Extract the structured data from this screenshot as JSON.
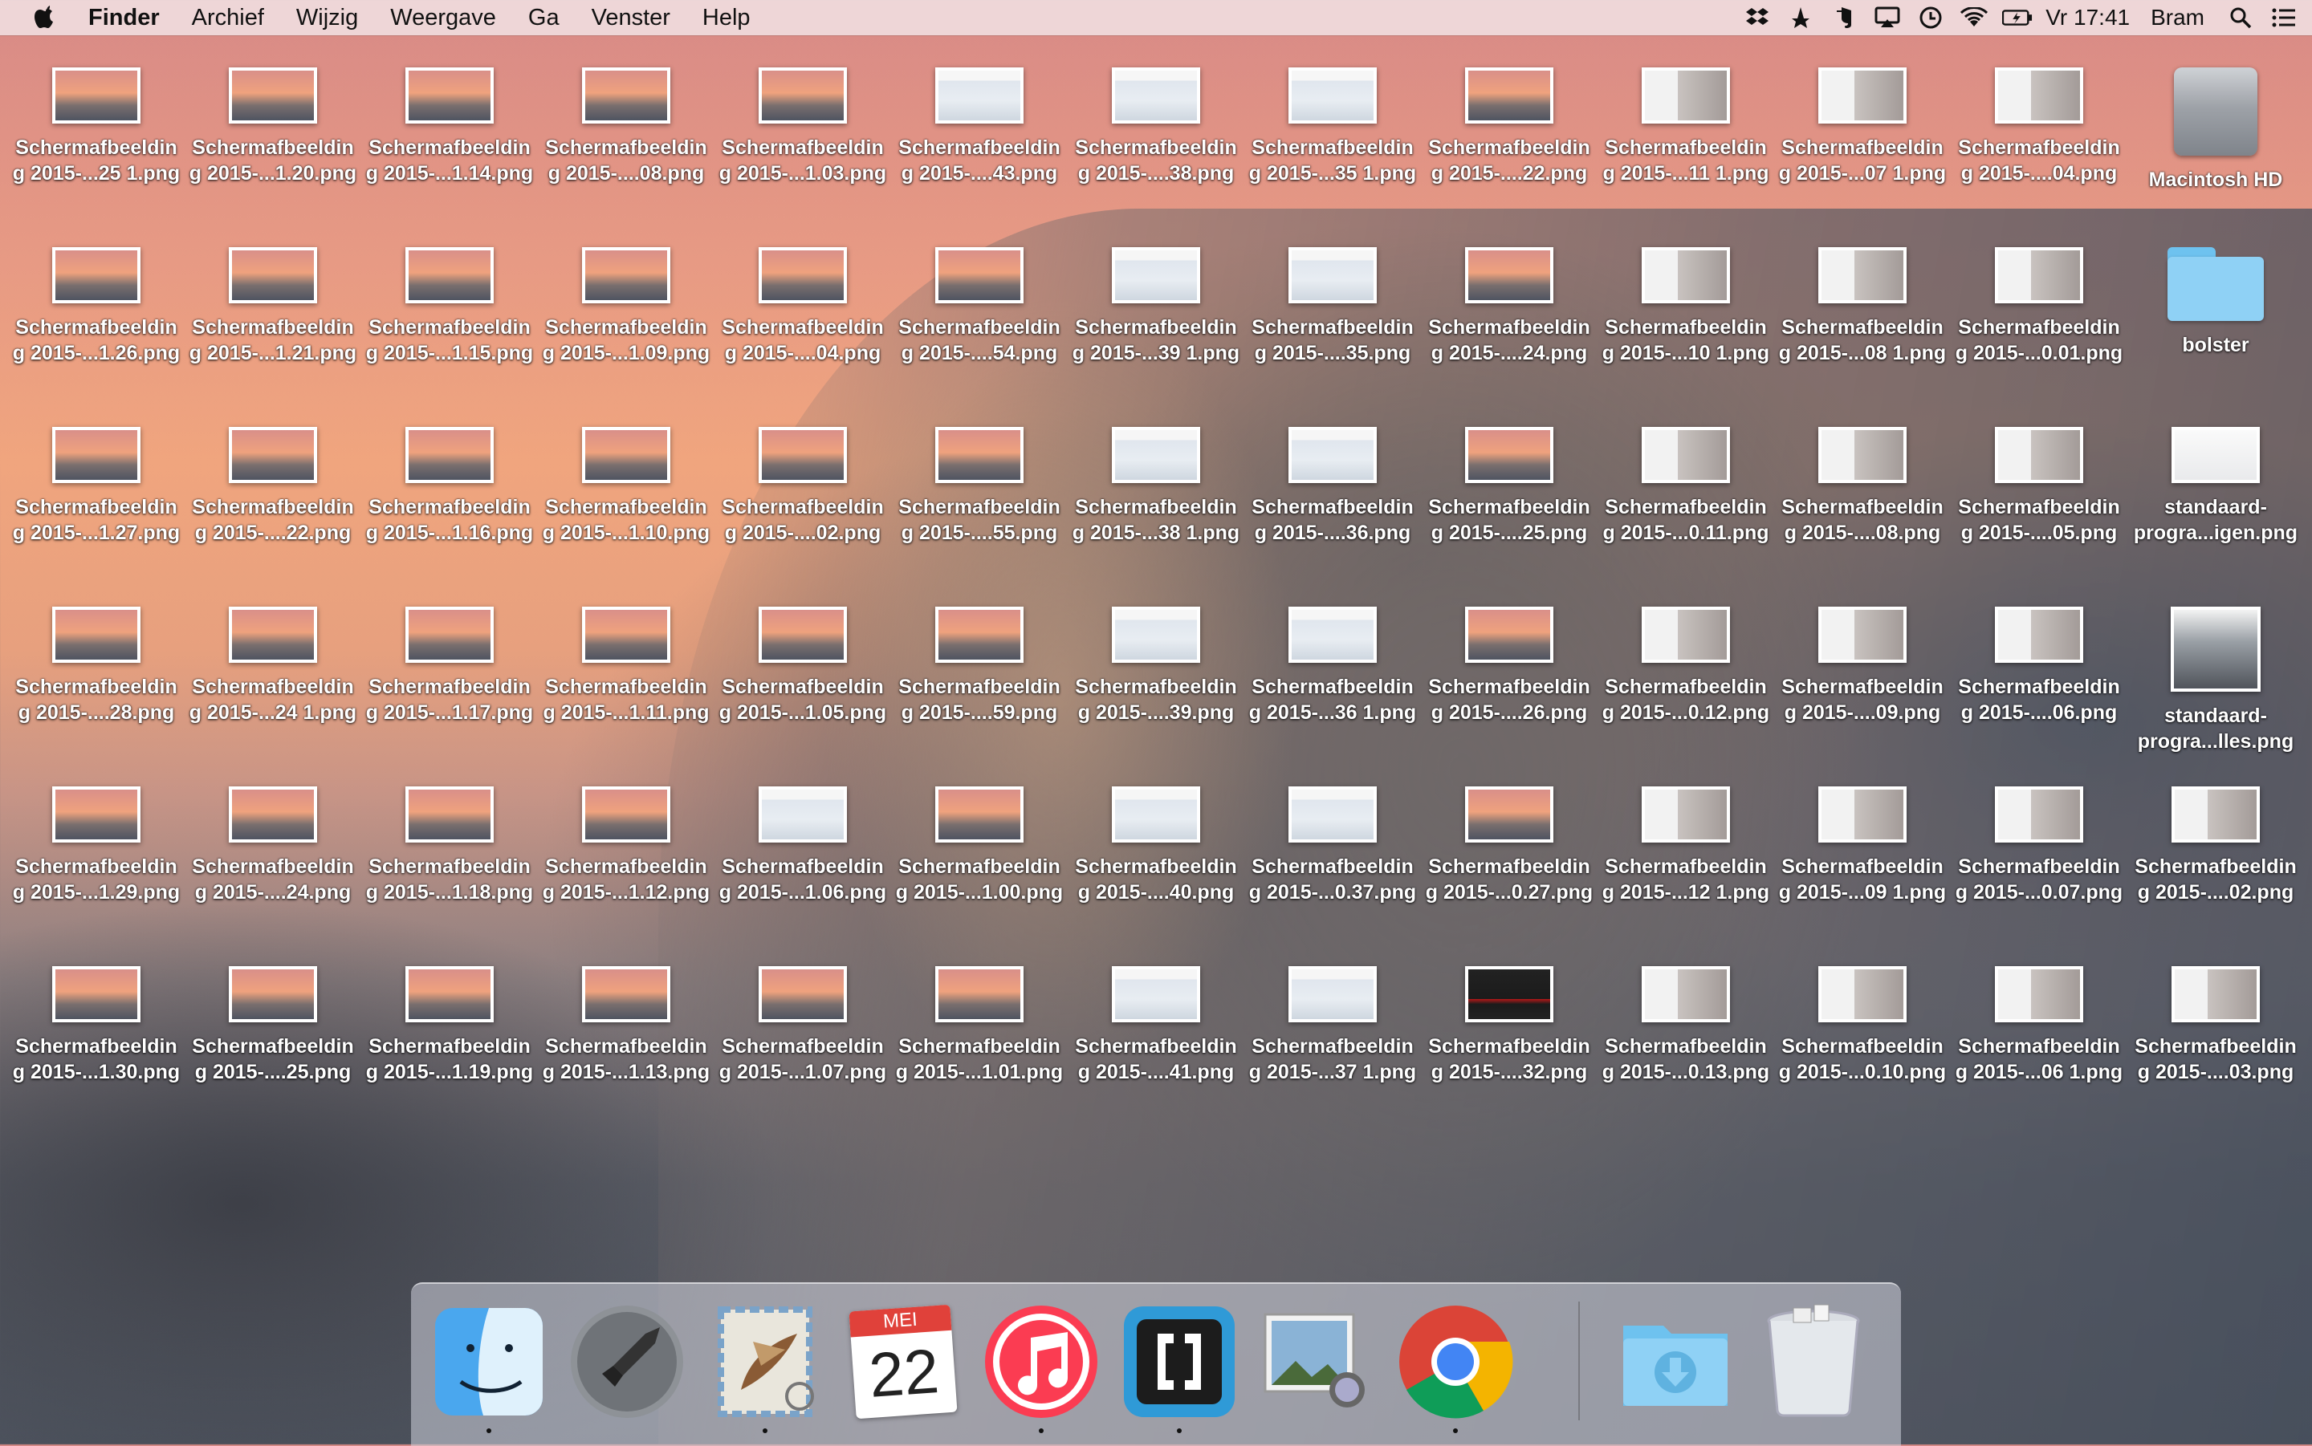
{
  "menubar": {
    "app_name": "Finder",
    "menus": [
      "Archief",
      "Wijzig",
      "Weergave",
      "Ga",
      "Venster",
      "Help"
    ],
    "clock": "Vr 17:41",
    "user": "Bram"
  },
  "desktop_icons": [
    {
      "l1": "Schermafbeeldin",
      "l2": "g 2015-...25 1.png",
      "t": "sunset"
    },
    {
      "l1": "Schermafbeeldin",
      "l2": "g 2015-...1.20.png",
      "t": "sunset"
    },
    {
      "l1": "Schermafbeeldin",
      "l2": "g 2015-...1.14.png",
      "t": "sunset"
    },
    {
      "l1": "Schermafbeeldin",
      "l2": "g 2015-....08.png",
      "t": "sunset"
    },
    {
      "l1": "Schermafbeeldin",
      "l2": "g 2015-...1.03.png",
      "t": "sunset"
    },
    {
      "l1": "Schermafbeeldin",
      "l2": "g 2015-....43.png",
      "t": "window"
    },
    {
      "l1": "Schermafbeeldin",
      "l2": "g 2015-....38.png",
      "t": "window"
    },
    {
      "l1": "Schermafbeeldin",
      "l2": "g 2015-...35 1.png",
      "t": "window"
    },
    {
      "l1": "Schermafbeeldin",
      "l2": "g 2015-....22.png",
      "t": "sunset"
    },
    {
      "l1": "Schermafbeeldin",
      "l2": "g 2015-...11 1.png",
      "t": "red"
    },
    {
      "l1": "Schermafbeeldin",
      "l2": "g 2015-...07 1.png",
      "t": "red"
    },
    {
      "l1": "Schermafbeeldin",
      "l2": "g 2015-....04.png",
      "t": "red"
    },
    {
      "l1": "Macintosh HD",
      "l2": "",
      "t": "hd"
    },
    {
      "l1": "Schermafbeeldin",
      "l2": "g 2015-...1.26.png",
      "t": "sunset"
    },
    {
      "l1": "Schermafbeeldin",
      "l2": "g 2015-...1.21.png",
      "t": "sunset"
    },
    {
      "l1": "Schermafbeeldin",
      "l2": "g 2015-...1.15.png",
      "t": "sunset"
    },
    {
      "l1": "Schermafbeeldin",
      "l2": "g 2015-...1.09.png",
      "t": "sunset"
    },
    {
      "l1": "Schermafbeeldin",
      "l2": "g 2015-....04.png",
      "t": "sunset"
    },
    {
      "l1": "Schermafbeeldin",
      "l2": "g 2015-....54.png",
      "t": "sunset"
    },
    {
      "l1": "Schermafbeeldin",
      "l2": "g 2015-...39 1.png",
      "t": "window"
    },
    {
      "l1": "Schermafbeeldin",
      "l2": "g 2015-....35.png",
      "t": "window"
    },
    {
      "l1": "Schermafbeeldin",
      "l2": "g 2015-....24.png",
      "t": "sunset"
    },
    {
      "l1": "Schermafbeeldin",
      "l2": "g 2015-...10 1.png",
      "t": "red"
    },
    {
      "l1": "Schermafbeeldin",
      "l2": "g 2015-...08 1.png",
      "t": "red"
    },
    {
      "l1": "Schermafbeeldin",
      "l2": "g 2015-...0.01.png",
      "t": "red"
    },
    {
      "l1": "bolster",
      "l2": "",
      "t": "folder"
    },
    {
      "l1": "Schermafbeeldin",
      "l2": "g 2015-...1.27.png",
      "t": "sunset"
    },
    {
      "l1": "Schermafbeeldin",
      "l2": "g 2015-....22.png",
      "t": "sunset"
    },
    {
      "l1": "Schermafbeeldin",
      "l2": "g 2015-...1.16.png",
      "t": "sunset"
    },
    {
      "l1": "Schermafbeeldin",
      "l2": "g 2015-...1.10.png",
      "t": "sunset"
    },
    {
      "l1": "Schermafbeeldin",
      "l2": "g 2015-....02.png",
      "t": "sunset"
    },
    {
      "l1": "Schermafbeeldin",
      "l2": "g 2015-....55.png",
      "t": "sunset"
    },
    {
      "l1": "Schermafbeeldin",
      "l2": "g 2015-...38 1.png",
      "t": "window"
    },
    {
      "l1": "Schermafbeeldin",
      "l2": "g 2015-....36.png",
      "t": "window"
    },
    {
      "l1": "Schermafbeeldin",
      "l2": "g 2015-....25.png",
      "t": "sunset"
    },
    {
      "l1": "Schermafbeeldin",
      "l2": "g 2015-...0.11.png",
      "t": "red"
    },
    {
      "l1": "Schermafbeeldin",
      "l2": "g 2015-....08.png",
      "t": "red"
    },
    {
      "l1": "Schermafbeeldin",
      "l2": "g 2015-....05.png",
      "t": "red"
    },
    {
      "l1": "standaard-",
      "l2": "progra...igen.png",
      "t": "doc"
    },
    {
      "l1": "Schermafbeeldin",
      "l2": "g 2015-....28.png",
      "t": "sunset"
    },
    {
      "l1": "Schermafbeeldin",
      "l2": "g 2015-...24 1.png",
      "t": "sunset"
    },
    {
      "l1": "Schermafbeeldin",
      "l2": "g 2015-...1.17.png",
      "t": "sunset"
    },
    {
      "l1": "Schermafbeeldin",
      "l2": "g 2015-...1.11.png",
      "t": "sunset"
    },
    {
      "l1": "Schermafbeeldin",
      "l2": "g 2015-...1.05.png",
      "t": "sunset"
    },
    {
      "l1": "Schermafbeeldin",
      "l2": "g 2015-....59.png",
      "t": "sunset"
    },
    {
      "l1": "Schermafbeeldin",
      "l2": "g 2015-....39.png",
      "t": "window"
    },
    {
      "l1": "Schermafbeeldin",
      "l2": "g 2015-...36 1.png",
      "t": "window"
    },
    {
      "l1": "Schermafbeeldin",
      "l2": "g 2015-....26.png",
      "t": "sunset"
    },
    {
      "l1": "Schermafbeeldin",
      "l2": "g 2015-...0.12.png",
      "t": "red"
    },
    {
      "l1": "Schermafbeeldin",
      "l2": "g 2015-....09.png",
      "t": "red"
    },
    {
      "l1": "Schermafbeeldin",
      "l2": "g 2015-....06.png",
      "t": "red"
    },
    {
      "l1": "standaard-",
      "l2": "progra...lles.png",
      "t": "photo"
    },
    {
      "l1": "Schermafbeeldin",
      "l2": "g 2015-...1.29.png",
      "t": "sunset"
    },
    {
      "l1": "Schermafbeeldin",
      "l2": "g 2015-....24.png",
      "t": "sunset"
    },
    {
      "l1": "Schermafbeeldin",
      "l2": "g 2015-...1.18.png",
      "t": "sunset"
    },
    {
      "l1": "Schermafbeeldin",
      "l2": "g 2015-...1.12.png",
      "t": "sunset"
    },
    {
      "l1": "Schermafbeeldin",
      "l2": "g 2015-...1.06.png",
      "t": "window"
    },
    {
      "l1": "Schermafbeeldin",
      "l2": "g 2015-...1.00.png",
      "t": "sunset"
    },
    {
      "l1": "Schermafbeeldin",
      "l2": "g 2015-....40.png",
      "t": "window"
    },
    {
      "l1": "Schermafbeeldin",
      "l2": "g 2015-...0.37.png",
      "t": "window"
    },
    {
      "l1": "Schermafbeeldin",
      "l2": "g 2015-...0.27.png",
      "t": "sunset"
    },
    {
      "l1": "Schermafbeeldin",
      "l2": "g 2015-...12 1.png",
      "t": "red"
    },
    {
      "l1": "Schermafbeeldin",
      "l2": "g 2015-...09 1.png",
      "t": "red"
    },
    {
      "l1": "Schermafbeeldin",
      "l2": "g 2015-...0.07.png",
      "t": "red"
    },
    {
      "l1": "Schermafbeeldin",
      "l2": "g 2015-....02.png",
      "t": "red"
    },
    {
      "l1": "Schermafbeeldin",
      "l2": "g 2015-...1.30.png",
      "t": "sunset"
    },
    {
      "l1": "Schermafbeeldin",
      "l2": "g 2015-....25.png",
      "t": "sunset"
    },
    {
      "l1": "Schermafbeeldin",
      "l2": "g 2015-...1.19.png",
      "t": "sunset"
    },
    {
      "l1": "Schermafbeeldin",
      "l2": "g 2015-...1.13.png",
      "t": "sunset"
    },
    {
      "l1": "Schermafbeeldin",
      "l2": "g 2015-...1.07.png",
      "t": "sunset"
    },
    {
      "l1": "Schermafbeeldin",
      "l2": "g 2015-...1.01.png",
      "t": "sunset"
    },
    {
      "l1": "Schermafbeeldin",
      "l2": "g 2015-....41.png",
      "t": "window"
    },
    {
      "l1": "Schermafbeeldin",
      "l2": "g 2015-...37 1.png",
      "t": "window"
    },
    {
      "l1": "Schermafbeeldin",
      "l2": "g 2015-....32.png",
      "t": "dark"
    },
    {
      "l1": "Schermafbeeldin",
      "l2": "g 2015-...0.13.png",
      "t": "red"
    },
    {
      "l1": "Schermafbeeldin",
      "l2": "g 2015-...0.10.png",
      "t": "red"
    },
    {
      "l1": "Schermafbeeldin",
      "l2": "g 2015-...06 1.png",
      "t": "red"
    },
    {
      "l1": "Schermafbeeldin",
      "l2": "g 2015-....03.png",
      "t": "red"
    }
  ],
  "dock": {
    "calendar_month": "MEI",
    "calendar_day": "22",
    "apps": [
      "finder-icon",
      "launchpad-icon",
      "mail-icon",
      "calendar-icon",
      "itunes-icon",
      "brackets-icon",
      "preview-icon",
      "chrome-icon",
      "downloads-icon",
      "trash-icon"
    ]
  },
  "colors": {
    "folder_blue": "#8fd1f5",
    "chrome_red": "#db4437",
    "chrome_green": "#0f9d58",
    "chrome_yellow": "#f4b400",
    "chrome_blue": "#4285f4",
    "itunes_red": "#fb3c52"
  }
}
